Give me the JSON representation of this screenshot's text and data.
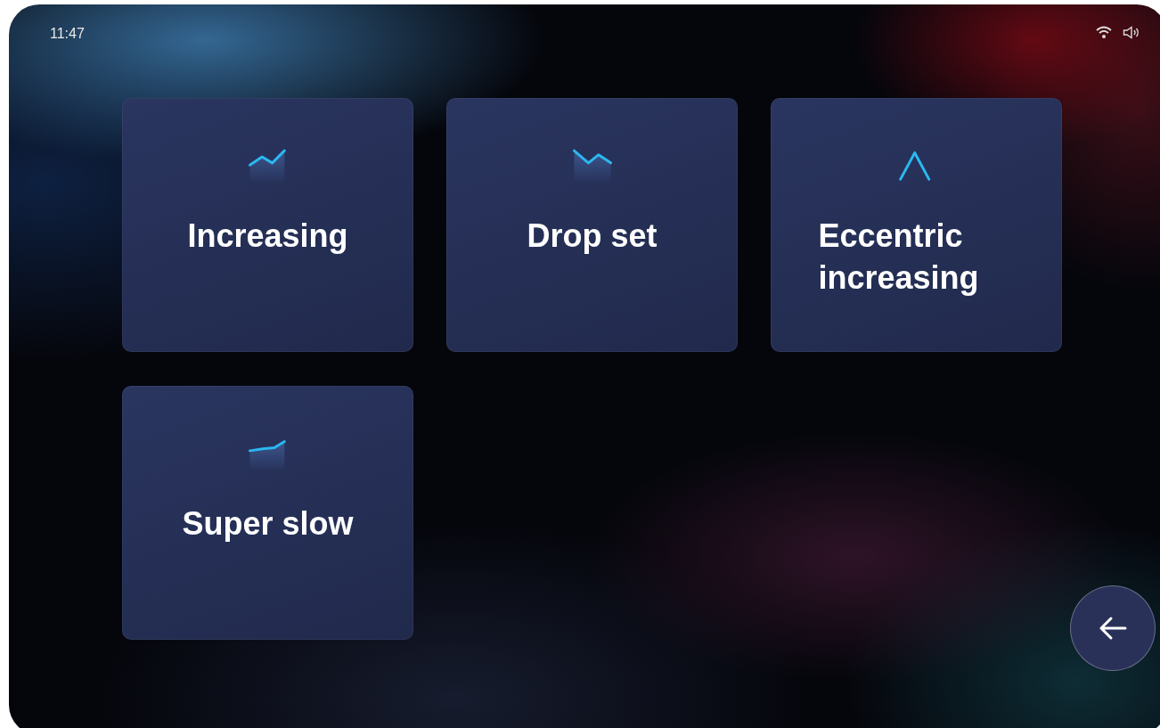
{
  "status_bar": {
    "time": "11:47"
  },
  "modes": [
    {
      "label": "Increasing",
      "kind": "rise"
    },
    {
      "label": "Drop set",
      "kind": "drop"
    },
    {
      "label": "Eccentric increasing",
      "kind": "peak"
    },
    {
      "label": "Super slow",
      "kind": "slow"
    }
  ]
}
